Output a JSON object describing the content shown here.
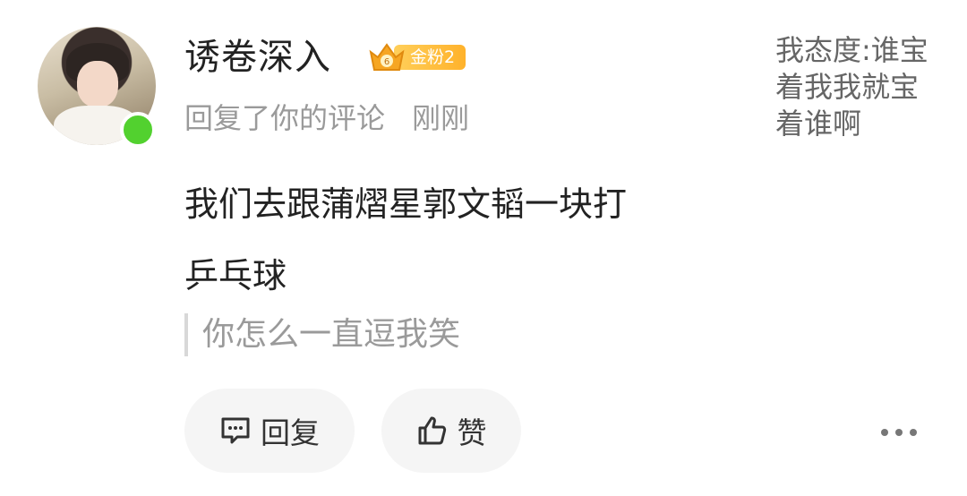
{
  "comment": {
    "username": "诱卷深入",
    "badge": {
      "label": "金粉2",
      "icon": "crown-icon",
      "color": "#ffb22b"
    },
    "action_text": "回复了你的评论",
    "time": "刚刚",
    "content_line1": "我们去跟蒲熠星郭文韬一块打",
    "content_line2": "乒乓球",
    "quoted_reply": "你怎么一直逗我笑",
    "original_comment": "我态度:谁宝着我我就宝着谁啊",
    "online_status_color": "#52d12f"
  },
  "actions": {
    "reply_label": "回复",
    "reply_icon": "comment-icon",
    "like_label": "赞",
    "like_icon": "thumbs-up-icon",
    "more_icon": "more-dots-icon"
  }
}
